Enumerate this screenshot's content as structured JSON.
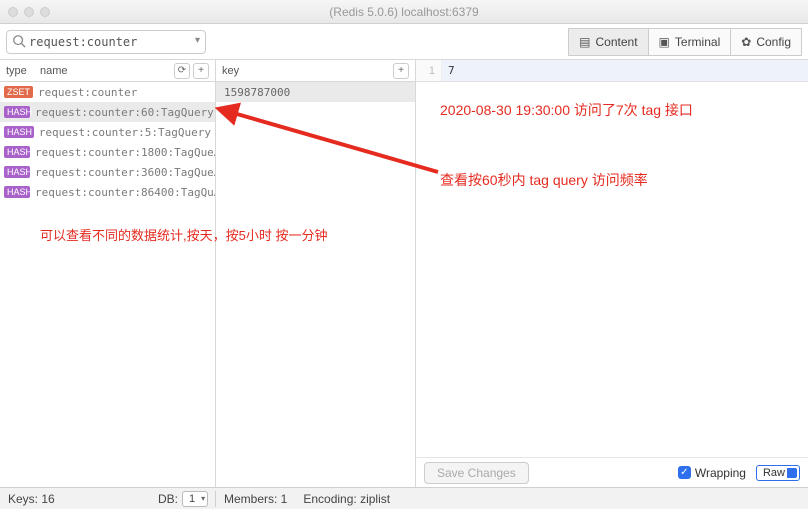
{
  "window": {
    "title": "(Redis 5.0.6) localhost:6379"
  },
  "search": {
    "value": "request:counter",
    "placeholder": ""
  },
  "tabs": {
    "content": "Content",
    "terminal": "Terminal",
    "config": "Config"
  },
  "left": {
    "typeHeader": "type",
    "nameHeader": "name",
    "rows": [
      {
        "type": "ZSET",
        "name": "request:counter"
      },
      {
        "type": "HASH",
        "name": "request:counter:60:TagQuery"
      },
      {
        "type": "HASH",
        "name": "request:counter:5:TagQuery"
      },
      {
        "type": "HASH",
        "name": "request:counter:1800:TagQue…"
      },
      {
        "type": "HASH",
        "name": "request:counter:3600:TagQue…"
      },
      {
        "type": "HASH",
        "name": "request:counter:86400:TagQu…"
      }
    ],
    "selectedIndex": 1
  },
  "mid": {
    "keyHeader": "key",
    "keys": [
      "1598787000"
    ]
  },
  "editor": {
    "lineNumber": "1",
    "value": "7"
  },
  "bottom": {
    "saveLabel": "Save Changes",
    "wrappingLabel": "Wrapping",
    "rawLabel": "Raw"
  },
  "status": {
    "keysLabel": "Keys: 16",
    "dbLabel": "DB:",
    "dbValue": "1",
    "membersLabel": "Members: 1",
    "encodingLabel": "Encoding: ziplist"
  },
  "annotations": {
    "a1": "2020-08-30 19:30:00 访问了7次 tag 接口",
    "a2": "查看按60秒内 tag query 访问频率",
    "a3": "可以查看不同的数据统计,按天，按5小时 按一分钟"
  }
}
